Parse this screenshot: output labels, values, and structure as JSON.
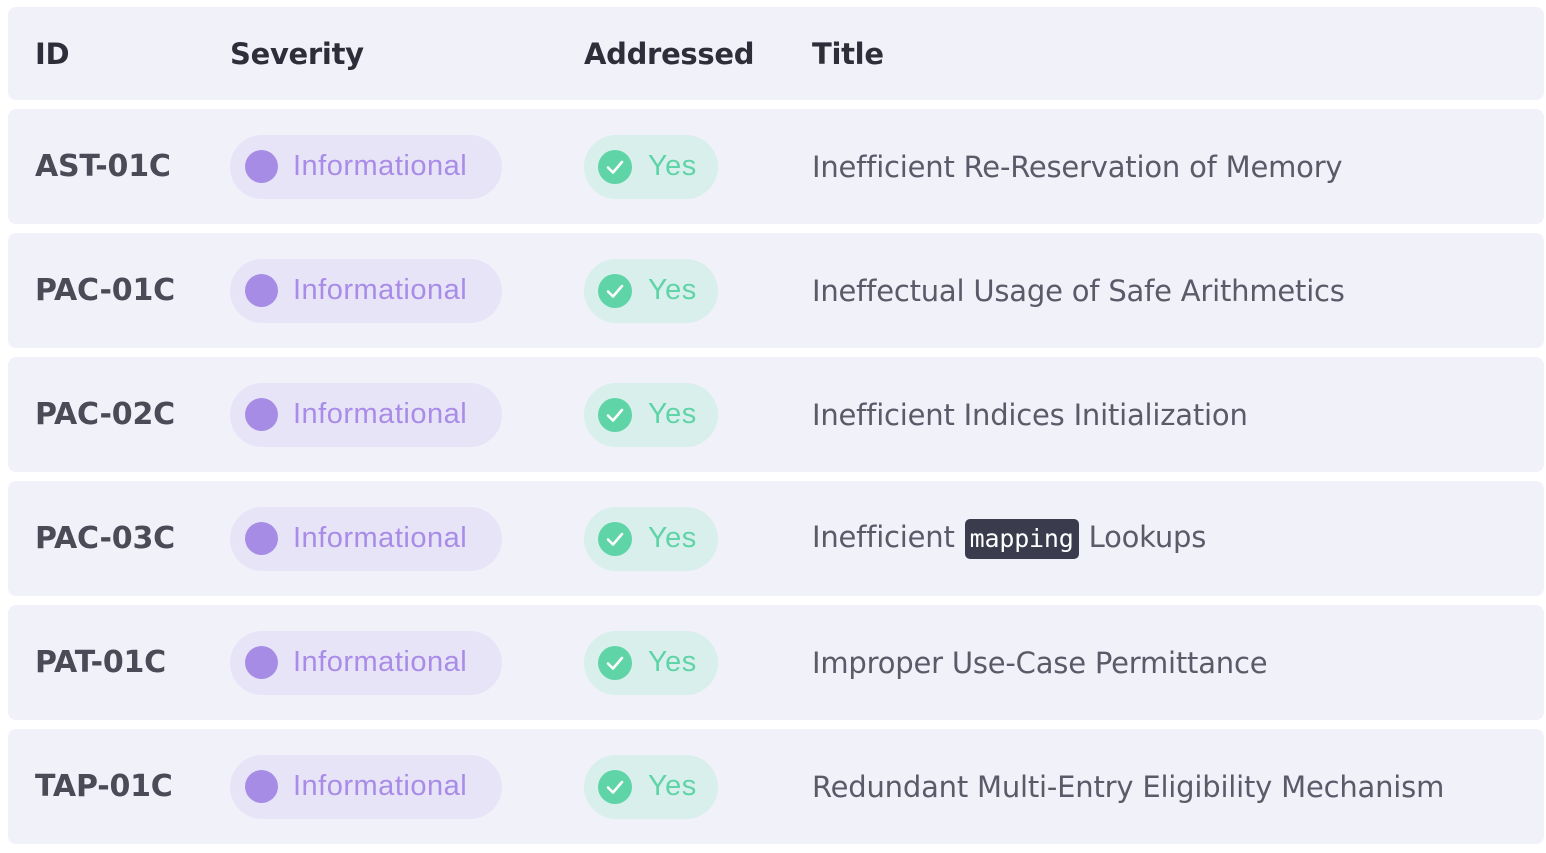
{
  "header": {
    "id": "ID",
    "severity": "Severity",
    "addressed": "Addressed",
    "title": "Title"
  },
  "colors": {
    "row_background": "#f1f1fa",
    "severity_pill": "#e8e4f7",
    "severity_dot": "#a78ce6",
    "severity_text": "#a98ce8",
    "addressed_pill": "#d9efec",
    "addressed_icon": "#5fd4a7",
    "code_background": "#3a3c4e"
  },
  "rows": [
    {
      "id": "AST-01C",
      "severity": "Informational",
      "addressed": "Yes",
      "title_before": "Inefficient Re-Reservation of Memory",
      "title_code": "",
      "title_after": ""
    },
    {
      "id": "PAC-01C",
      "severity": "Informational",
      "addressed": "Yes",
      "title_before": "Ineffectual Usage of Safe Arithmetics",
      "title_code": "",
      "title_after": ""
    },
    {
      "id": "PAC-02C",
      "severity": "Informational",
      "addressed": "Yes",
      "title_before": "Inefficient Indices Initialization",
      "title_code": "",
      "title_after": ""
    },
    {
      "id": "PAC-03C",
      "severity": "Informational",
      "addressed": "Yes",
      "title_before": "Inefficient",
      "title_code": "mapping",
      "title_after": "Lookups"
    },
    {
      "id": "PAT-01C",
      "severity": "Informational",
      "addressed": "Yes",
      "title_before": "Improper Use-Case Permittance",
      "title_code": "",
      "title_after": ""
    },
    {
      "id": "TAP-01C",
      "severity": "Informational",
      "addressed": "Yes",
      "title_before": "Redundant Multi-Entry Eligibility Mechanism",
      "title_code": "",
      "title_after": ""
    }
  ],
  "icons": {
    "severity": "circle-dot-icon",
    "addressed": "check-circle-icon"
  }
}
